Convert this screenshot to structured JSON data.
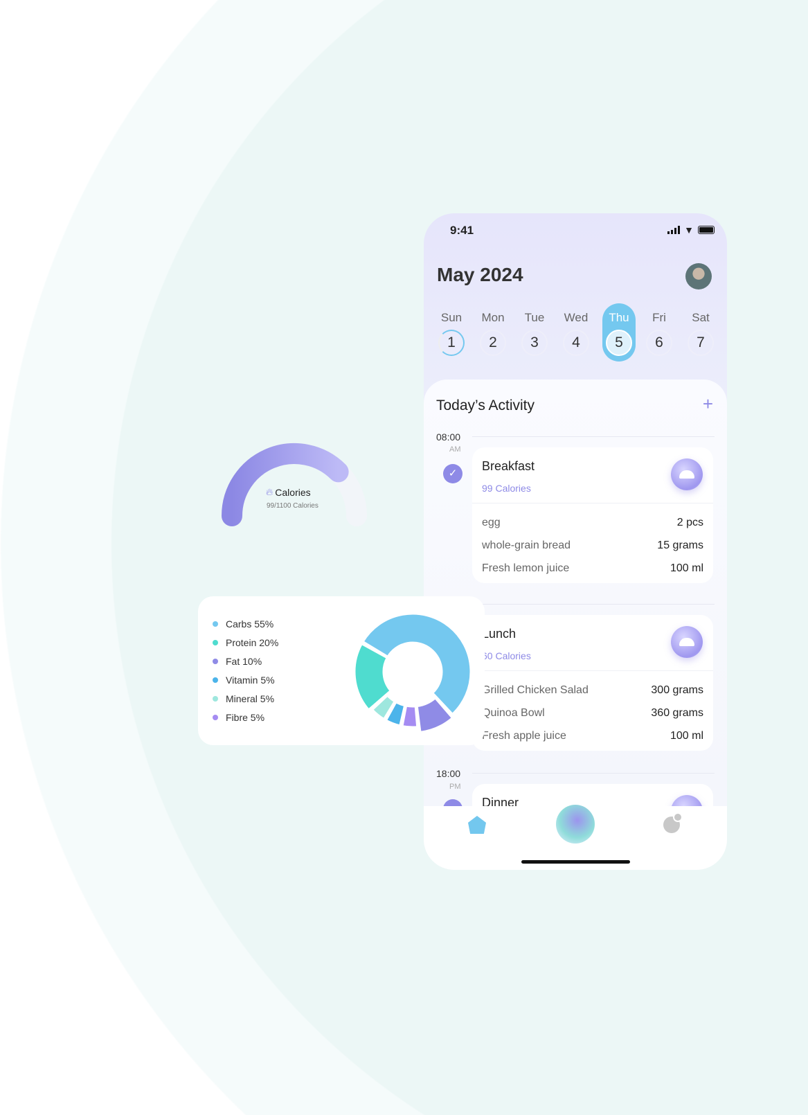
{
  "status": {
    "time": "9:41"
  },
  "header": {
    "title": "May 2024"
  },
  "week": [
    {
      "day": "Sun",
      "date": "1"
    },
    {
      "day": "Mon",
      "date": "2"
    },
    {
      "day": "Tue",
      "date": "3"
    },
    {
      "day": "Wed",
      "date": "4"
    },
    {
      "day": "Thu",
      "date": "5",
      "selected": true
    },
    {
      "day": "Fri",
      "date": "6"
    },
    {
      "day": "Sat",
      "date": "7"
    }
  ],
  "activity": {
    "title": "Today’s Activity",
    "add_icon": "plus-icon",
    "meals": [
      {
        "time": "08:00",
        "period": "AM",
        "name": "Breakfast",
        "calories": "99 Calories",
        "done": true,
        "items": [
          {
            "food": "egg",
            "qty": "2 pcs"
          },
          {
            "food": "whole-grain bread",
            "qty": "15 grams"
          },
          {
            "food": "Fresh lemon juice",
            "qty": "100 ml"
          }
        ]
      },
      {
        "name": "Lunch",
        "calories": "60 Calories",
        "items": [
          {
            "food": "Grilled Chicken Salad",
            "qty": "300 grams"
          },
          {
            "food": "Quinoa Bowl",
            "qty": "360 grams"
          },
          {
            "food": "Fresh apple juice",
            "qty": "100 ml"
          }
        ]
      },
      {
        "time": "18:00",
        "period": "PM",
        "name": "Dinner"
      }
    ]
  },
  "nav": [
    "home-icon",
    "assistant-orb",
    "pie-chart-icon"
  ],
  "calories_widget": {
    "label": "Calories",
    "value_text": "99/1100 Calories",
    "progress": 0.75,
    "color": "#8e8ae6"
  },
  "chart_data": {
    "type": "pie",
    "donut": true,
    "categories": [
      "Carbs",
      "Protein",
      "Fat",
      "Vitamin",
      "Mineral",
      "Fibre"
    ],
    "values": [
      55,
      20,
      10,
      5,
      5,
      5
    ],
    "labels": [
      "Carbs 55%",
      "Protein 20%",
      "Fat 10%",
      "Vitamin 5%",
      "Mineral 5%",
      "Fibre 5%"
    ],
    "colors": [
      "#74c8ef",
      "#4fdccf",
      "#8f8be6",
      "#4cb4ea",
      "#9ee7de",
      "#a58cf2"
    ],
    "legend": "left"
  }
}
